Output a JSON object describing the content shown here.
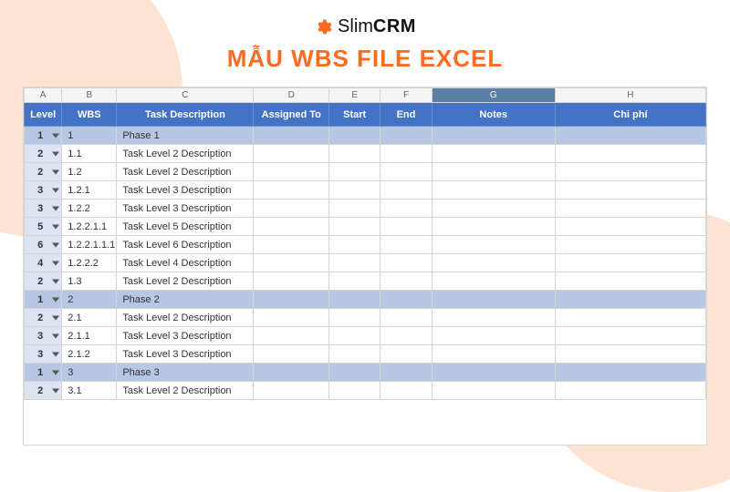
{
  "brand": {
    "name_light": "Slim",
    "name_bold": "CRM"
  },
  "headline": "MẪU WBS FILE EXCEL",
  "columns": {
    "letters": [
      "A",
      "B",
      "C",
      "D",
      "E",
      "F",
      "G",
      "H"
    ],
    "selected": "G"
  },
  "headers": {
    "level": "Level",
    "wbs": "WBS",
    "desc": "Task Description",
    "assigned": "Assigned To",
    "start": "Start",
    "end": "End",
    "notes": "Notes",
    "cost": "Chi phí"
  },
  "rows": [
    {
      "level": "1",
      "wbs": "1",
      "desc": "Phase 1",
      "phase": true
    },
    {
      "level": "2",
      "wbs": "1.1",
      "desc": "Task Level 2 Description",
      "phase": false
    },
    {
      "level": "2",
      "wbs": "1.2",
      "desc": "Task Level 2 Description",
      "phase": false
    },
    {
      "level": "3",
      "wbs": "1.2.1",
      "desc": "Task Level 3 Description",
      "phase": false
    },
    {
      "level": "3",
      "wbs": "1.2.2",
      "desc": "Task Level 3 Description",
      "phase": false
    },
    {
      "level": "5",
      "wbs": "1.2.2.1.1",
      "desc": "Task Level 5 Description",
      "phase": false
    },
    {
      "level": "6",
      "wbs": "1.2.2.1.1.1",
      "desc": "Task Level 6 Description",
      "phase": false
    },
    {
      "level": "4",
      "wbs": "1.2.2.2",
      "desc": "Task Level 4 Description",
      "phase": false
    },
    {
      "level": "2",
      "wbs": "1.3",
      "desc": "Task Level 2 Description",
      "phase": false
    },
    {
      "level": "1",
      "wbs": "2",
      "desc": "Phase 2",
      "phase": true
    },
    {
      "level": "2",
      "wbs": "2.1",
      "desc": "Task Level 2 Description",
      "phase": false
    },
    {
      "level": "3",
      "wbs": "2.1.1",
      "desc": "Task Level 3 Description",
      "phase": false
    },
    {
      "level": "3",
      "wbs": "2.1.2",
      "desc": "Task Level 3 Description",
      "phase": false
    },
    {
      "level": "1",
      "wbs": "3",
      "desc": "Phase 3",
      "phase": true
    },
    {
      "level": "2",
      "wbs": "3.1",
      "desc": "Task Level 2 Description",
      "phase": false
    }
  ]
}
